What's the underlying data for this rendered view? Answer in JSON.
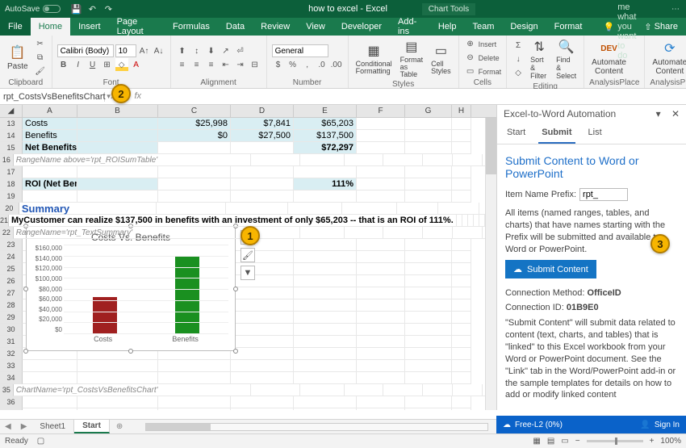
{
  "titlebar": {
    "autosave_label": "AutoSave",
    "doc_title": "how to excel - Excel",
    "context_tab": "Chart Tools"
  },
  "tabs": {
    "items": [
      "File",
      "Home",
      "Insert",
      "Page Layout",
      "Formulas",
      "Data",
      "Review",
      "View",
      "Developer",
      "Add-ins",
      "Help",
      "Team",
      "Design",
      "Format"
    ],
    "active": "Home",
    "tellme": "Tell me what you want to do",
    "share": "Share"
  },
  "ribbon": {
    "clipboard": {
      "paste": "Paste",
      "label": "Clipboard"
    },
    "font": {
      "family": "Calibri (Body)",
      "size": "10",
      "label": "Font"
    },
    "alignment": {
      "label": "Alignment"
    },
    "number": {
      "format": "General",
      "label": "Number"
    },
    "styles": {
      "cond": "Conditional Formatting",
      "table": "Format as Table",
      "cell": "Cell Styles",
      "label": "Styles"
    },
    "cells": {
      "insert": "Insert",
      "delete": "Delete",
      "format": "Format",
      "label": "Cells"
    },
    "editing": {
      "sort": "Sort & Filter",
      "find": "Find & Select",
      "label": "Editing"
    },
    "ap1": {
      "line1": "Automate",
      "line2": "Content",
      "label": "AnalysisPlace"
    },
    "ap2": {
      "line1": "Automate",
      "line2": "Content",
      "label": "AnalysisPlace"
    }
  },
  "namebox": "rpt_CostsVsBenefitsChart",
  "sheet": {
    "rows": {
      "13": {
        "a": "Costs",
        "c": "$25,998",
        "d": "$7,841",
        "e": "$65,203"
      },
      "14": {
        "a": "Benefits",
        "c": "$0",
        "d": "$27,500",
        "e": "$137,500"
      },
      "15": {
        "a": "Net Benefits",
        "e": "$72,297"
      },
      "16": {
        "a": "RangeName above='rpt_ROISumTable'"
      },
      "18": {
        "a": "ROI (Net Benefits / Costs)",
        "e": "111%"
      },
      "20": {
        "a": "Summary"
      },
      "21": {
        "a": "MyCustomer can realize $137,500 in benefits with an investment of only $65,203 -- that is an ROI of 111%."
      },
      "22": {
        "a": "RangeName='rpt_TextSummary'"
      },
      "35": {
        "a": "ChartName='rpt_CostsVsBenefitsChart'"
      }
    }
  },
  "chart_data": {
    "type": "bar",
    "title": "Costs Vs. Benefits",
    "categories": [
      "Costs",
      "Benefits"
    ],
    "values": [
      65203,
      137500
    ],
    "colors": [
      "#a02020",
      "#1a9020"
    ],
    "ylim": [
      0,
      160000
    ],
    "ytick_step": 20000,
    "ytick_labels": [
      "$0",
      "$20,000",
      "$40,000",
      "$60,000",
      "$80,000",
      "$100,000",
      "$120,000",
      "$140,000",
      "$160,000"
    ]
  },
  "taskpane": {
    "title": "Excel-to-Word Automation",
    "tabs": [
      "Start",
      "Submit",
      "List"
    ],
    "active_tab": "Submit",
    "heading": "Submit Content to Word or PowerPoint",
    "prefix_label": "Item Name Prefix:",
    "prefix_value": "rpt_",
    "desc1": "All items (named ranges, tables, and charts) that have names starting with the Prefix will be submitted and available to Word or PowerPoint.",
    "submit_btn": "Submit Content",
    "conn_method_label": "Connection Method:",
    "conn_method_value": "OfficeID",
    "conn_id_label": "Connection ID:",
    "conn_id_value": "01B9E0",
    "desc2": "\"Submit Content\" will submit data related to content (text, charts, and tables) that is \"linked\" to this Excel workbook from your Word or PowerPoint document. See the \"Link\" tab in the Word/PowerPoint add-in or the sample templates for details on how to add or modify linked content"
  },
  "signin": {
    "plan": "Free-L2 (0%)",
    "btn": "Sign In"
  },
  "sheettabs": {
    "items": [
      "Sheet1",
      "Start"
    ],
    "active": "Start"
  },
  "status": {
    "ready": "Ready",
    "zoom": "100%"
  },
  "callouts": {
    "one": "1",
    "two": "2",
    "three": "3"
  }
}
